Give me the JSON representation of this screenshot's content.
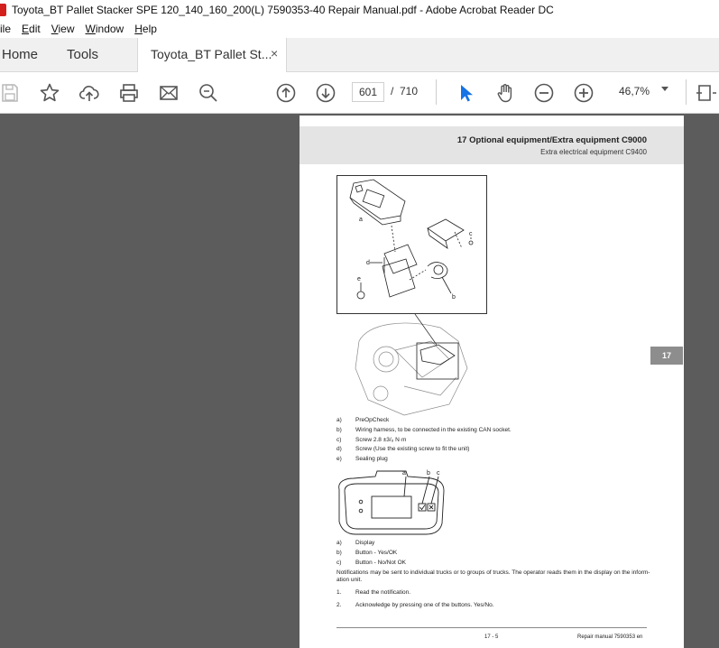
{
  "window": {
    "title": "Toyota_BT Pallet Stacker SPE 120_140_160_200(L) 7590353-40 Repair Manual.pdf - Adobe Acrobat Reader DC"
  },
  "menu": [
    {
      "label": "ile",
      "underline": ""
    },
    {
      "label": "Edit",
      "underline": "E"
    },
    {
      "label": "View",
      "underline": "V"
    },
    {
      "label": "Window",
      "underline": "W"
    },
    {
      "label": "Help",
      "underline": "H"
    }
  ],
  "tabs": {
    "home": "Home",
    "tools": "Tools",
    "document": "Toyota_BT Pallet St...",
    "close": "×"
  },
  "toolbar": {
    "icons": [
      "save-icon",
      "bookmark-star-icon",
      "upload-cloud-icon",
      "print-icon",
      "email-icon",
      "search-zoom-icon",
      "prev-page-icon",
      "next-page-icon",
      "select-arrow-icon",
      "hand-icon",
      "zoom-out-icon",
      "zoom-in-icon",
      "fit-page-icon"
    ],
    "page_current": "601",
    "page_separator": "/",
    "page_total": "710",
    "zoom": "46,7%"
  },
  "colors": {
    "accent": "#1473e6",
    "viewer_bg": "#5c5c5c",
    "header_band": "#e4e4e4",
    "badge": "#8d8d8d"
  },
  "page": {
    "header_title": "17 Optional equipment/Extra equipment C9000",
    "header_subtitle": "Extra electrical equipment C9400",
    "chapter_badge": "17",
    "fig1_labels": {
      "a": "a",
      "b": "b",
      "c": "c",
      "d": "d",
      "e": "e"
    },
    "legend1": [
      {
        "key": "a)",
        "text": "PreOpCheck"
      },
      {
        "key": "b)",
        "text": "Wiring harness, to be connected in the existing CAN socket."
      },
      {
        "key": "c)",
        "text": "Screw 2.8 ±3/₆ N·m"
      },
      {
        "key": "d)",
        "text": "Screw (Use the existing screw to fit the unit)"
      },
      {
        "key": "e)",
        "text": "Sealing plug"
      }
    ],
    "fig2_labels": {
      "a": "a",
      "b": "b",
      "c": "c"
    },
    "legend2": [
      {
        "key": "a)",
        "text": "Display"
      },
      {
        "key": "b)",
        "text": "Button - Yes/OK"
      },
      {
        "key": "c)",
        "text": "Button - No/Not OK"
      }
    ],
    "notification_line1": "Notifications may be sent to individual trucks or to groups of trucks. The operator reads them in the display on the inform-",
    "notification_line2": "ation unit.",
    "steps": [
      {
        "key": "1.",
        "text": "Read the notification."
      },
      {
        "key": "2.",
        "text": "Acknowledge by pressing one of the buttons. Yes/No."
      }
    ],
    "footer_page": "17 - 5",
    "footer_title": "Repair manual 7590353 en"
  }
}
